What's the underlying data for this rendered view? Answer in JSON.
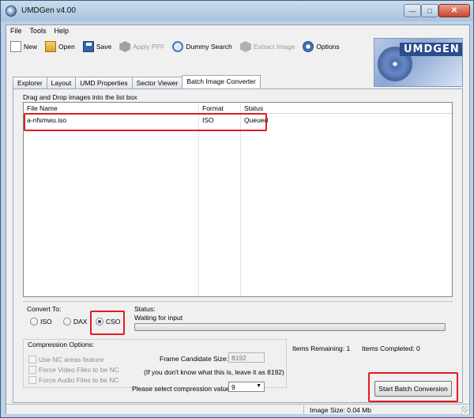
{
  "window": {
    "title": "UMDGen v4.00"
  },
  "menu": [
    "File",
    "Tools",
    "Help"
  ],
  "toolbar": {
    "new": "New",
    "open": "Open",
    "save": "Save",
    "apply_ppf": "Apply PPF",
    "dummy_search": "Dummy Search",
    "extract_image": "Extract Image",
    "options": "Options"
  },
  "logo": {
    "text": "UMDGEN"
  },
  "tabs": [
    "Explorer",
    "Layout",
    "UMD Properties",
    "Sector Viewer",
    "Batch Image Converter"
  ],
  "active_tab": "Batch Image Converter",
  "batch": {
    "drag_hint": "Drag and Drop images into the list box",
    "columns": {
      "file_name": "File Name",
      "format": "Format",
      "status": "Status"
    },
    "rows": [
      {
        "file_name": "a-nfsmwu.iso",
        "format": "ISO",
        "status": "Queued"
      }
    ],
    "convert_to_label": "Convert To:",
    "convert_options": [
      "ISO",
      "DAX",
      "CSO"
    ],
    "convert_selected": "CSO",
    "status_label": "Status:",
    "status_value": "Waiting for input",
    "progress": 0,
    "compression_label": "Compression Options:",
    "checkboxes": [
      "Use NC areas feature",
      "Force Video Files to be NC",
      "Force Audio Files to be NC"
    ],
    "frame_candidate_label": "Frame Candidate Size:",
    "frame_candidate_value": "8192",
    "frame_candidate_note": "(If you don't know what this is, leave it as 8192)",
    "compression_value_label": "Please select compression value:",
    "compression_value": "9",
    "items_remaining": "Items Remaining: 1",
    "items_completed": "Items Completed: 0",
    "start_button": "Start Batch Conversion"
  },
  "statusbar": {
    "image_size": "Image Size: 0.04 Mb"
  },
  "colors": {
    "highlight": "#e01c24",
    "title_bar": "#bcd2e8",
    "close_button": "#c8442c"
  }
}
